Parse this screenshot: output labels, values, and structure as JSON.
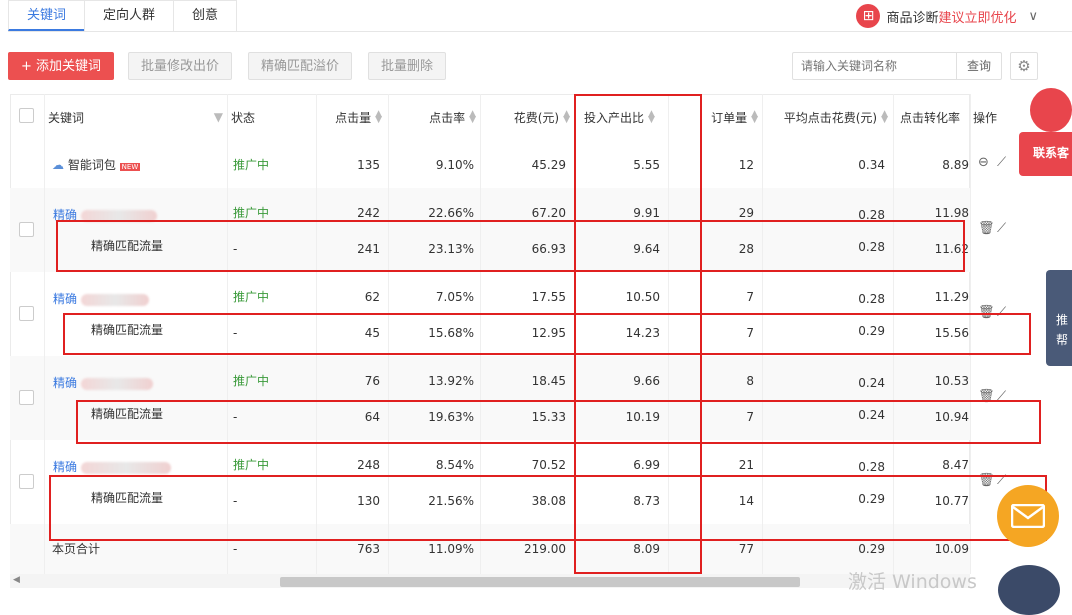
{
  "tabs": [
    "关键词",
    "定向人群",
    "创意"
  ],
  "diagnosis": {
    "icon": "diagnosis-icon",
    "label": "商品诊断",
    "link": "建议立即优化"
  },
  "toolbar": {
    "add": "+ 添加关键词",
    "batch_price": "批量修改出价",
    "exact_premium": "精确匹配溢价",
    "batch_delete": "批量删除"
  },
  "search": {
    "placeholder": "请输入关键词名称",
    "button": "查询"
  },
  "columns": {
    "keyword": "关键词",
    "status": "状态",
    "clicks": "点击量",
    "ctr": "点击率",
    "cost": "花费(元)",
    "roi": "投入产出比",
    "orders": "订单量",
    "cpc": "平均点击花费(元)",
    "cvr": "点击转化率",
    "ops": "操作"
  },
  "rows": [
    {
      "name": "智能词包",
      "badge": "NEW",
      "status": "推广中",
      "clicks": "135",
      "ctr": "9.10%",
      "cost": "45.29",
      "roi": "5.55",
      "orders": "12",
      "cpc": "0.34",
      "cvr": "8.89"
    },
    {
      "name": "精确",
      "status": "推广中",
      "clicks": "242",
      "ctr": "22.66%",
      "cost": "67.20",
      "roi": "9.91",
      "orders": "29",
      "cpc": "0.28",
      "cvr": "11.98",
      "sub": {
        "name": "精确匹配流量",
        "status": "-",
        "clicks": "241",
        "ctr": "23.13%",
        "cost": "66.93",
        "roi": "9.64",
        "orders": "28",
        "cpc": "0.28",
        "cvr": "11.62"
      }
    },
    {
      "name": "精确",
      "status": "推广中",
      "clicks": "62",
      "ctr": "7.05%",
      "cost": "17.55",
      "roi": "10.50",
      "orders": "7",
      "cpc": "0.28",
      "cvr": "11.29",
      "sub": {
        "name": "精确匹配流量",
        "status": "-",
        "clicks": "45",
        "ctr": "15.68%",
        "cost": "12.95",
        "roi": "14.23",
        "orders": "7",
        "cpc": "0.29",
        "cvr": "15.56"
      }
    },
    {
      "name": "精确",
      "status": "推广中",
      "clicks": "76",
      "ctr": "13.92%",
      "cost": "18.45",
      "roi": "9.66",
      "orders": "8",
      "cpc": "0.24",
      "cvr": "10.53",
      "sub": {
        "name": "精确匹配流量",
        "status": "-",
        "clicks": "64",
        "ctr": "19.63%",
        "cost": "15.33",
        "roi": "10.19",
        "orders": "7",
        "cpc": "0.24",
        "cvr": "10.94"
      }
    },
    {
      "name": "精确",
      "status": "推广中",
      "clicks": "248",
      "ctr": "8.54%",
      "cost": "70.52",
      "roi": "6.99",
      "orders": "21",
      "cpc": "0.28",
      "cvr": "8.47",
      "sub": {
        "name": "精确匹配流量",
        "status": "-",
        "clicks": "130",
        "ctr": "21.56%",
        "cost": "38.08",
        "roi": "8.73",
        "orders": "14",
        "cpc": "0.29",
        "cvr": "10.77"
      }
    }
  ],
  "total": {
    "name": "本页合计",
    "status": "-",
    "clicks": "763",
    "ctr": "11.09%",
    "cost": "219.00",
    "roi": "8.09",
    "orders": "77",
    "cpc": "0.29",
    "cvr": "10.09"
  },
  "side": {
    "contact": "联系客",
    "help_a": "推",
    "help_b": "帮"
  },
  "watermark": "激活 Windows",
  "colors": {
    "accent": "#3b7ae0",
    "primary": "#ec5050",
    "status": "#3a9a3a",
    "highlight": "#e02020"
  }
}
